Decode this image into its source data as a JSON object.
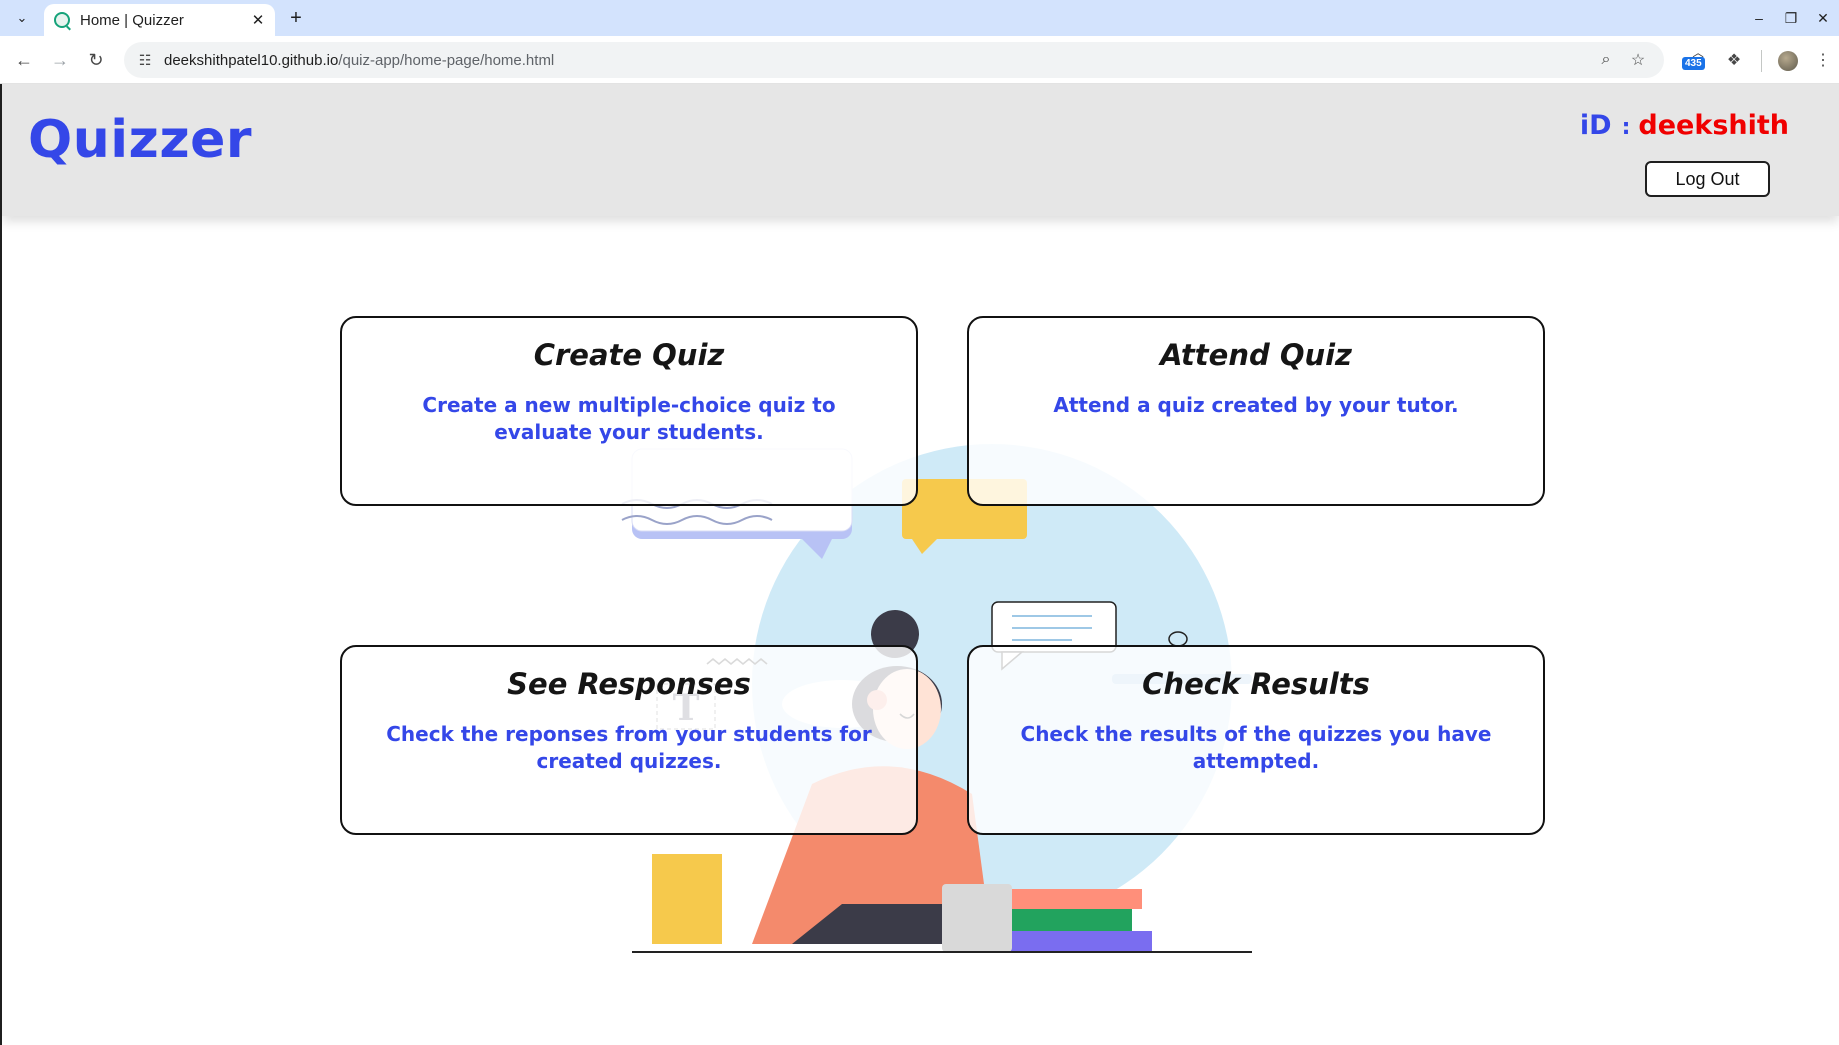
{
  "browser": {
    "tab_title": "Home | Quizzer",
    "url_host": "deekshithpatel10.github.io",
    "url_path": "/quiz-app/home-page/home.html",
    "extension_badge": "435",
    "icons": [
      "tab-search-icon",
      "close-icon",
      "new-tab-icon",
      "minimize-icon",
      "restore-icon",
      "close-window-icon",
      "back-icon",
      "forward-icon",
      "reload-icon",
      "site-info-icon",
      "zoom-icon",
      "bookmark-star-icon",
      "extension-icon",
      "puzzle-icon",
      "profile-avatar",
      "kebab-menu-icon"
    ]
  },
  "header": {
    "logo": "Quizzer",
    "id_label": "iD",
    "id_separator": ":",
    "username": "deekshith",
    "logout_label": "Log Out"
  },
  "cards": [
    {
      "title": "Create Quiz",
      "description": "Create a new multiple-choice quiz to evaluate your students."
    },
    {
      "title": "Attend Quiz",
      "description": "Attend a quiz created by your tutor."
    },
    {
      "title": "See Responses",
      "description": "Check the reponses from your students for created quizzes."
    },
    {
      "title": "Check Results",
      "description": "Check the results of the quizzes you have attempted."
    }
  ],
  "colors": {
    "brand_blue": "#3447e8",
    "username_red": "#f00000",
    "header_bg": "#e6e6e6",
    "tabbar_bg": "#d3e3fd"
  }
}
